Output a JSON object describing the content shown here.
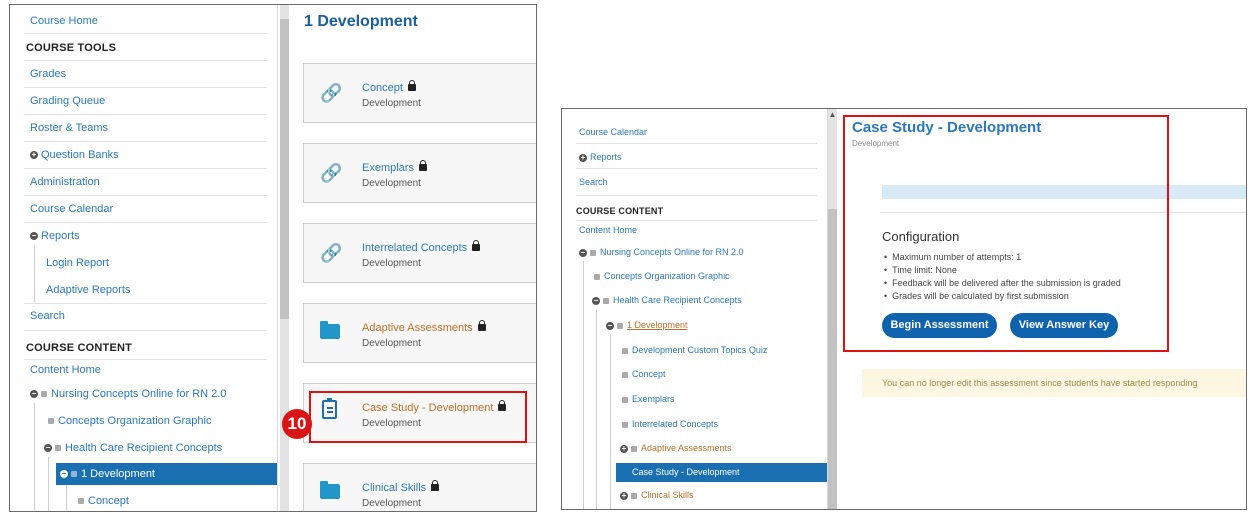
{
  "left_panel": {
    "sidebar": {
      "course_home": "Course Home",
      "course_tools_heading": "COURSE TOOLS",
      "tools": [
        "Grades",
        "Grading Queue",
        "Roster & Teams",
        "Question Banks",
        "Administration",
        "Course Calendar",
        "Reports",
        "Login Report",
        "Adaptive Reports",
        "Search"
      ],
      "course_content_heading": "COURSE CONTENT",
      "content_home": "Content Home",
      "tree": [
        "Nursing Concepts Online for RN 2.0",
        "Concepts Organization Graphic",
        "Health Care Recipient Concepts",
        "1 Development",
        "Concept"
      ]
    },
    "page_title": "1 Development",
    "cards": [
      {
        "title": "Concept",
        "subtitle": "Development",
        "icon": "link-icon"
      },
      {
        "title": "Exemplars",
        "subtitle": "Development",
        "icon": "link-icon"
      },
      {
        "title": "Interrelated Concepts",
        "subtitle": "Development",
        "icon": "link-icon"
      },
      {
        "title": "Adaptive Assessments",
        "subtitle": "Development",
        "icon": "folder-icon"
      },
      {
        "title": "Case Study - Development",
        "subtitle": "Development",
        "icon": "document-icon"
      },
      {
        "title": "Clinical Skills",
        "subtitle": "Development",
        "icon": "folder-icon"
      }
    ],
    "step_badge": "10"
  },
  "right_panel": {
    "sidebar": {
      "items_top": [
        "Course Calendar",
        "Reports",
        "Search"
      ],
      "course_content_heading": "COURSE CONTENT",
      "content_home": "Content Home",
      "tree": [
        "Nursing Concepts Online for RN 2.0",
        "Concepts Organization Graphic",
        "Health Care Recipient Concepts",
        "1 Development",
        "Development Custom Topics Quiz",
        "Concept",
        "Exemplars",
        "Interrelated Concepts",
        "Adaptive Assessments",
        "Case Study - Development",
        "Clinical Skills"
      ]
    },
    "title": "Case Study - Development",
    "subtitle": "Development",
    "configuration_heading": "Configuration",
    "configuration_items": [
      "Maximum number of attempts: 1",
      "Time limit: None",
      "Feedback will be delivered after the submission is graded",
      "Grades will be calculated by first submission"
    ],
    "begin_button": "Begin Assessment",
    "answer_key_button": "View Answer Key",
    "notice": "You can no longer edit this assessment since students have started responding"
  },
  "colors": {
    "link": "#2a7ab8",
    "selected": "#1a6fb0",
    "highlight_box": "#e01010",
    "primary_button": "#0f63ad"
  }
}
